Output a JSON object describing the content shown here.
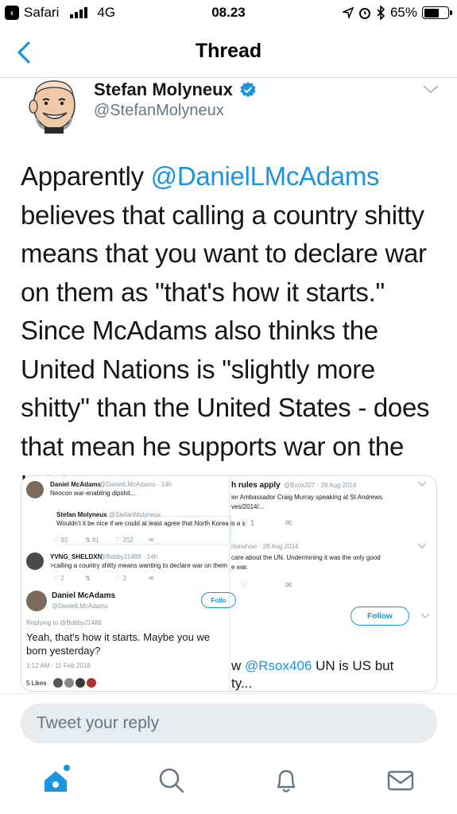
{
  "status_bar": {
    "back_app": "Safari",
    "network": "4G",
    "time": "08.23",
    "battery": "65%",
    "battery_level": 0.65
  },
  "nav": {
    "title": "Thread"
  },
  "tweet": {
    "author_name": "Stefan Molyneux",
    "handle": "@StefanMolyneux",
    "text_parts": {
      "lead": "Apparently ",
      "mention": "@DanielLMcAdams",
      "body": "believes that calling a country shitty means that you want to declare war on them as \"that's how it starts.\" Since McAdams also thinks the United Nations is \"slightly more shitty\" than the United States - does that mean he supports war on the US?"
    }
  },
  "media": {
    "left": {
      "tweet1_name": "Daniel McAdams",
      "tweet1_handle_time": "@DanielLMcAdams · 14h",
      "tweet1_text": "Neocon war-enabling dipshit...",
      "quoted_name": "Stefan Molyneux",
      "quoted_handle": "@StefanMolyneux",
      "quoted_text": "Wouldn't it be nice if we could at least agree that North Korea is a s",
      "t1_replies": "92",
      "t1_retweets": "81",
      "t1_likes": "252",
      "tweet2_name": "YVNG_SHELDXN",
      "tweet2_handle_time": "@BobbyJ1488 · 14h",
      "tweet2_text": ">calling a country shitty means wanting to declare war on them",
      "t2_replies": "2",
      "t2_likes": "3",
      "main_name": "Daniel McAdams",
      "main_handle": "@DanielLMcAdams",
      "follow": "Follo",
      "replying_to": "Replying to @BobbyJ1488",
      "main_text_1": "Yeah, that's how it starts. Maybe you we",
      "main_text_2": "born yesterday?",
      "timestamp": "1:12 AM - 11 Feb 2018",
      "likes": "5 Likes"
    },
    "right": {
      "r1_name": "h rules apply",
      "r1_meta": "@Bsox327 · 28 Aug 2014",
      "r1_line1": "ier Ambassador Craig Murray speaking at St Andrews.",
      "r1_line2": "ves/2014/...",
      "r1_likes": "1",
      "r2_meta": "rtonshow · 28 Aug 2014",
      "r2_line1": "care about the UN. Undermining it was the only good",
      "r2_line2": "e war.",
      "follow": "Follow",
      "big_prefix": "w ",
      "big_mention": "@Rsox406",
      "big_rest": " UN is US but",
      "big_line2": "ty..."
    }
  },
  "reply": {
    "placeholder": "Tweet your reply"
  },
  "tabs": [
    "home",
    "search",
    "notifications",
    "messages"
  ],
  "colors": {
    "accent": "#1b95e0",
    "text": "#14171a",
    "muted": "#657786"
  }
}
